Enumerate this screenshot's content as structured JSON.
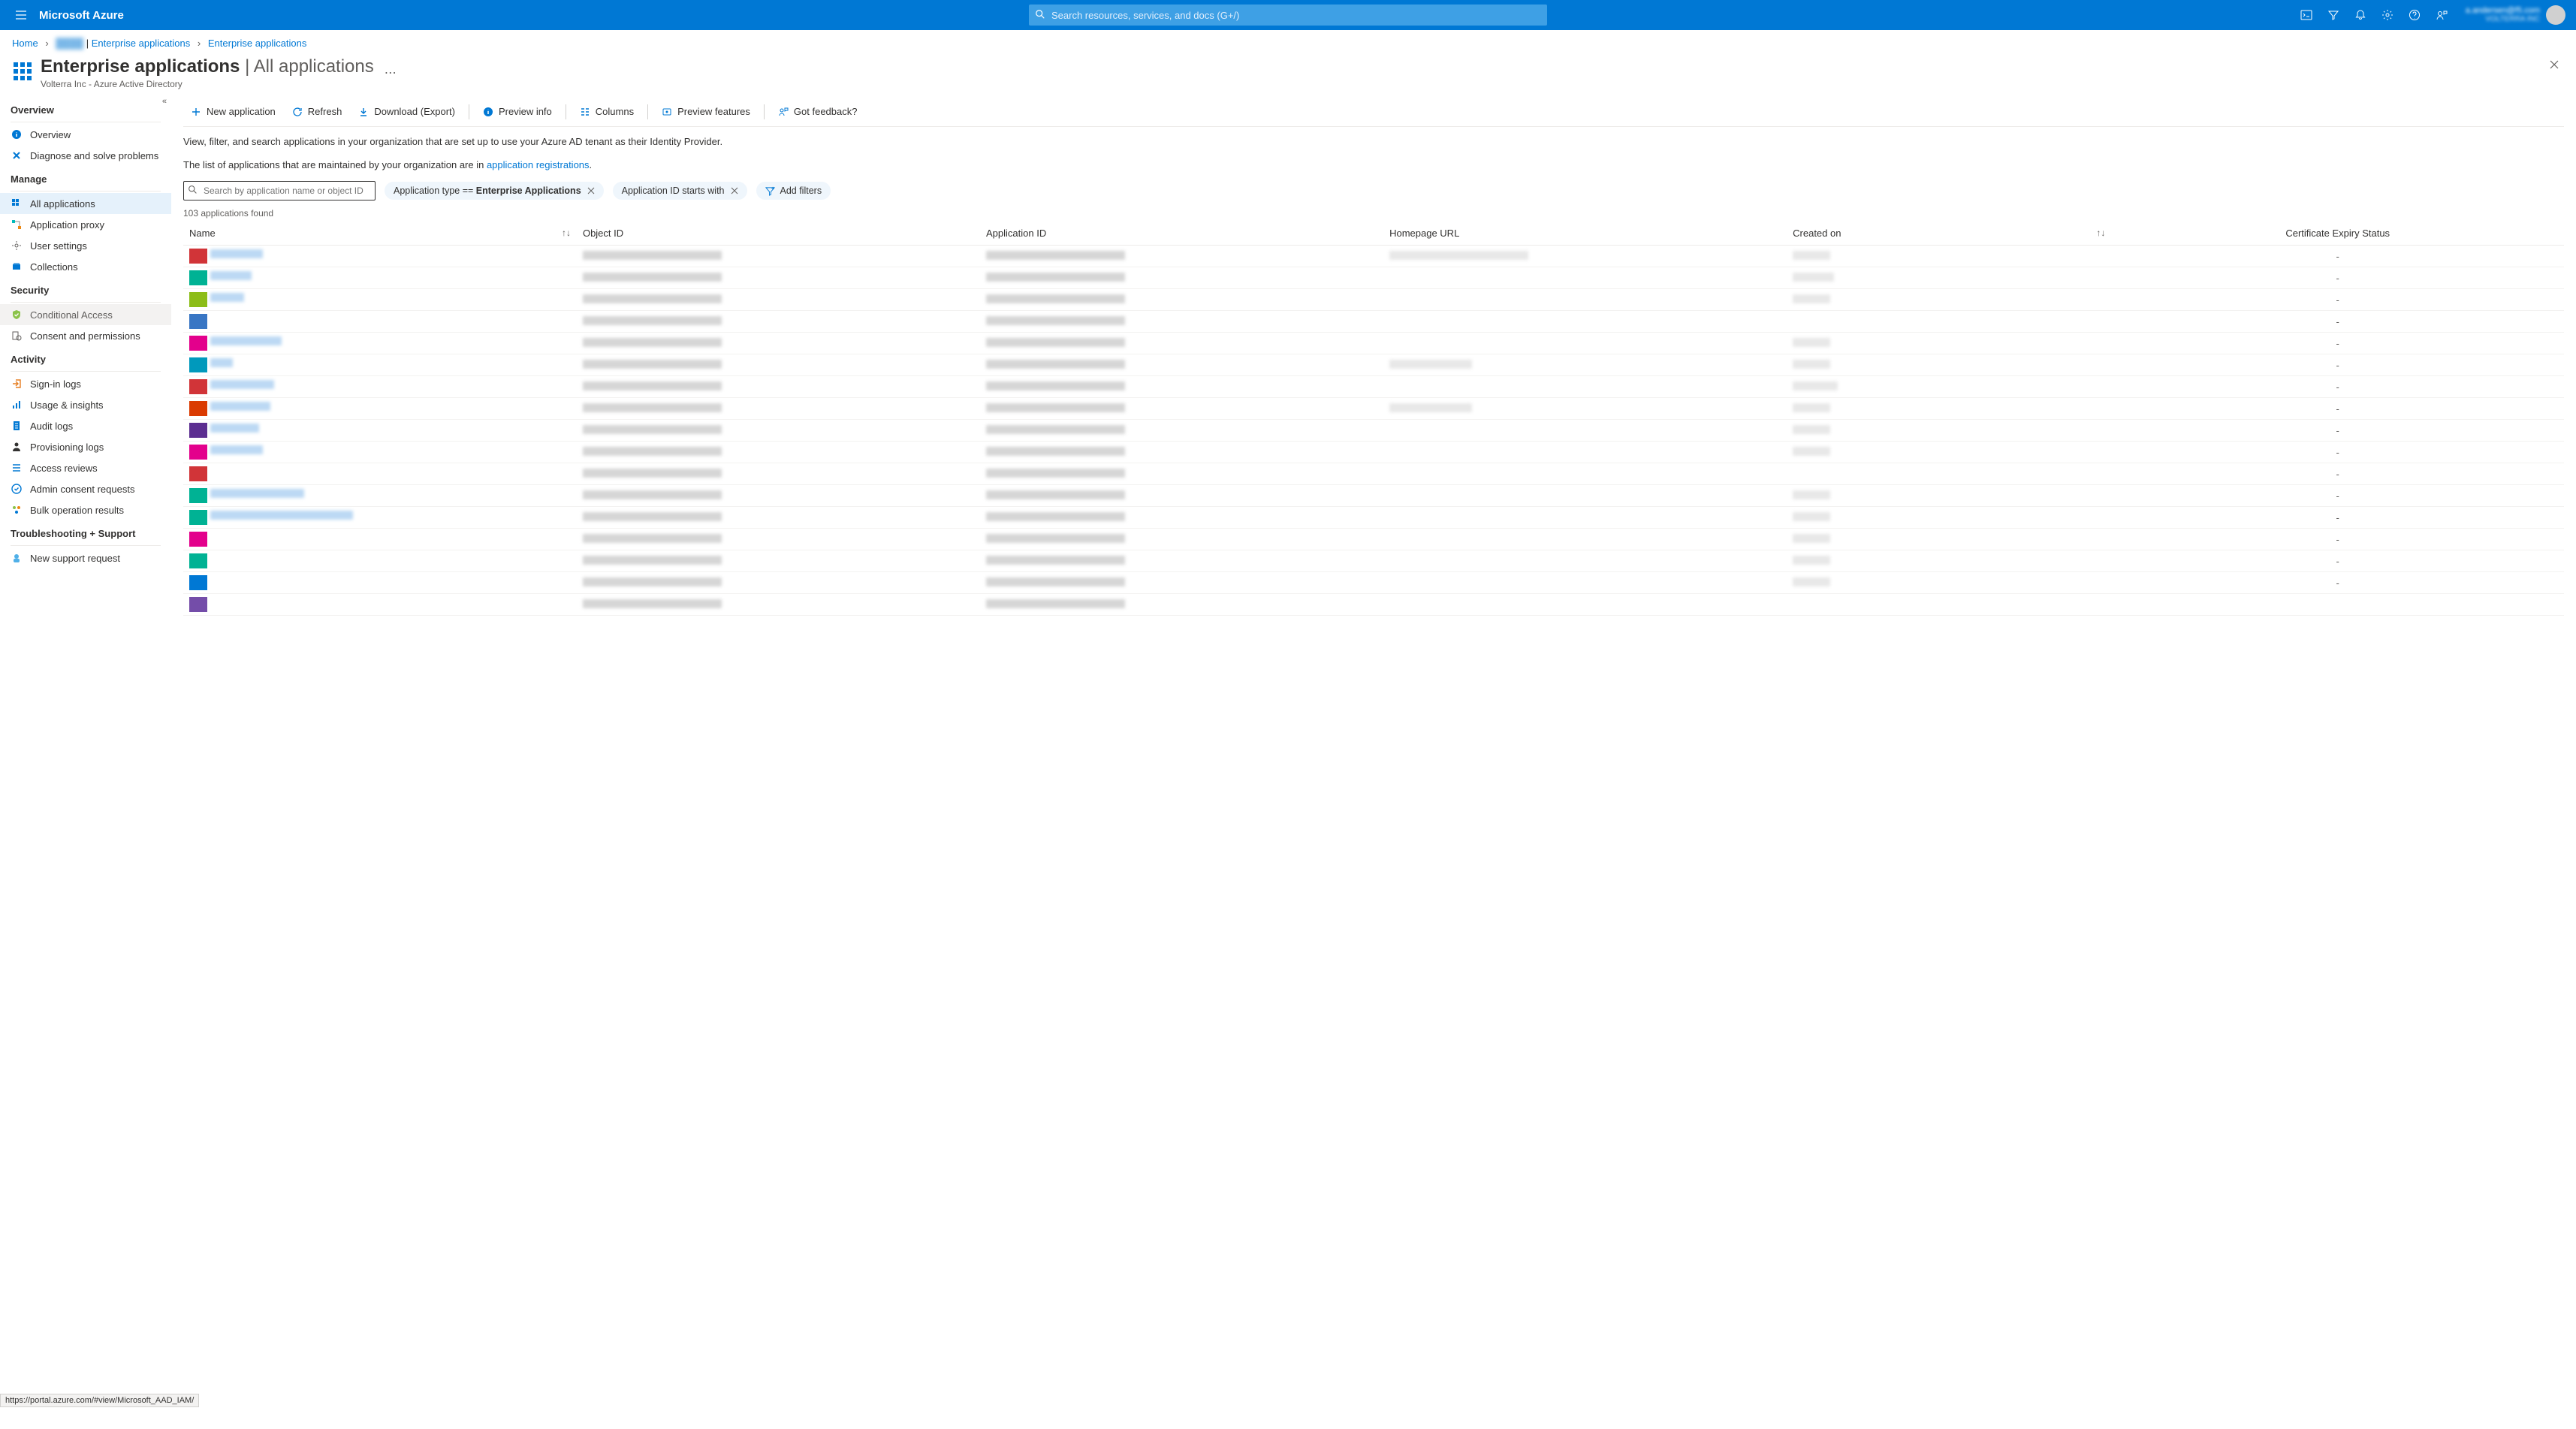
{
  "topbar": {
    "brand": "Microsoft Azure",
    "search_placeholder": "Search resources, services, and docs (G+/)",
    "account_email": "a.andersen@f5.com",
    "account_org": "VOLTERRA INC"
  },
  "breadcrumb": {
    "home": "Home",
    "org_blur": "████",
    "ent_apps": "Enterprise applications",
    "ent_apps2": "Enterprise applications"
  },
  "blade": {
    "title_strong": "Enterprise applications",
    "title_light": " | All applications",
    "subtitle": "Volterra Inc - Azure Active Directory"
  },
  "nav": {
    "sections": {
      "overview": "Overview",
      "manage": "Manage",
      "security": "Security",
      "activity": "Activity",
      "troubleshoot": "Troubleshooting + Support"
    },
    "items": {
      "overview": "Overview",
      "diagnose": "Diagnose and solve problems",
      "all_apps": "All applications",
      "app_proxy": "Application proxy",
      "user_settings": "User settings",
      "collections": "Collections",
      "cond_access": "Conditional Access",
      "consent": "Consent and permissions",
      "signin": "Sign-in logs",
      "usage": "Usage & insights",
      "audit": "Audit logs",
      "prov": "Provisioning logs",
      "access_rev": "Access reviews",
      "admin_consent": "Admin consent requests",
      "bulk": "Bulk operation results",
      "new_support": "New support request"
    }
  },
  "cmdbar": {
    "new_app": "New application",
    "refresh": "Refresh",
    "download": "Download (Export)",
    "preview_info": "Preview info",
    "columns": "Columns",
    "preview_feat": "Preview features",
    "feedback": "Got feedback?"
  },
  "desc": {
    "line1": "View, filter, and search applications in your organization that are set up to use your Azure AD tenant as their Identity Provider.",
    "line2a": "The list of applications that are maintained by your organization are in ",
    "link": "application registrations"
  },
  "filters": {
    "search_placeholder": "Search by application name or object ID",
    "pill1_key": "Application type == ",
    "pill1_val": "Enterprise Applications",
    "pill2": "Application ID starts with",
    "add": "Add filters"
  },
  "count": "103 applications found",
  "columns": {
    "name": "Name",
    "object_id": "Object ID",
    "app_id": "Application ID",
    "homepage": "Homepage URL",
    "created": "Created on",
    "cert": "Certificate Expiry Status"
  },
  "rows": [
    {
      "c": "#d13438",
      "nw": 70,
      "ow": 185,
      "aw": 185,
      "hw": 185,
      "cw": 50,
      "cert": "-"
    },
    {
      "c": "#00b294",
      "nw": 55,
      "ow": 185,
      "aw": 185,
      "hw": 0,
      "cw": 55,
      "cert": "-"
    },
    {
      "c": "#8cbd18",
      "nw": 45,
      "ow": 185,
      "aw": 185,
      "hw": 0,
      "cw": 50,
      "cert": "-"
    },
    {
      "c": "#3976c4",
      "nw": 0,
      "ow": 185,
      "aw": 185,
      "hw": 0,
      "cw": 0,
      "cert": "-"
    },
    {
      "c": "#e3008c",
      "nw": 95,
      "ow": 185,
      "aw": 185,
      "hw": 0,
      "cw": 50,
      "cert": "-"
    },
    {
      "c": "#0099bc",
      "nw": 30,
      "ow": 185,
      "aw": 185,
      "hw": 110,
      "cw": 50,
      "cert": "-"
    },
    {
      "c": "#d13438",
      "nw": 85,
      "ow": 185,
      "aw": 185,
      "hw": 0,
      "cw": 60,
      "cert": "-"
    },
    {
      "c": "#da3b01",
      "nw": 80,
      "ow": 185,
      "aw": 185,
      "hw": 110,
      "cw": 50,
      "cert": "-"
    },
    {
      "c": "#5c2e91",
      "nw": 65,
      "ow": 185,
      "aw": 185,
      "hw": 0,
      "cw": 50,
      "cert": "-"
    },
    {
      "c": "#e3008c",
      "nw": 70,
      "ow": 185,
      "aw": 185,
      "hw": 0,
      "cw": 50,
      "cert": "-"
    },
    {
      "c": "#d13438",
      "nw": 0,
      "ow": 185,
      "aw": 185,
      "hw": 0,
      "cw": 0,
      "cert": "-"
    },
    {
      "c": "#00b294",
      "nw": 125,
      "ow": 185,
      "aw": 185,
      "hw": 0,
      "cw": 50,
      "cert": "-"
    },
    {
      "c": "#00b294",
      "nw": 190,
      "ow": 185,
      "aw": 185,
      "hw": 0,
      "cw": 50,
      "cert": "-"
    },
    {
      "c": "#e3008c",
      "nw": 0,
      "ow": 185,
      "aw": 185,
      "hw": 0,
      "cw": 50,
      "cert": "-"
    },
    {
      "c": "#00b294",
      "nw": 0,
      "ow": 185,
      "aw": 185,
      "hw": 0,
      "cw": 50,
      "cert": "-"
    },
    {
      "c": "#0078d4",
      "nw": 0,
      "ow": 185,
      "aw": 185,
      "hw": 0,
      "cw": 50,
      "cert": "-"
    },
    {
      "c": "#744da9",
      "nw": 0,
      "ow": 185,
      "aw": 185,
      "hw": 0,
      "cw": 0,
      "cert": ""
    }
  ],
  "statusbar": "https://portal.azure.com/#view/Microsoft_AAD_IAM/"
}
